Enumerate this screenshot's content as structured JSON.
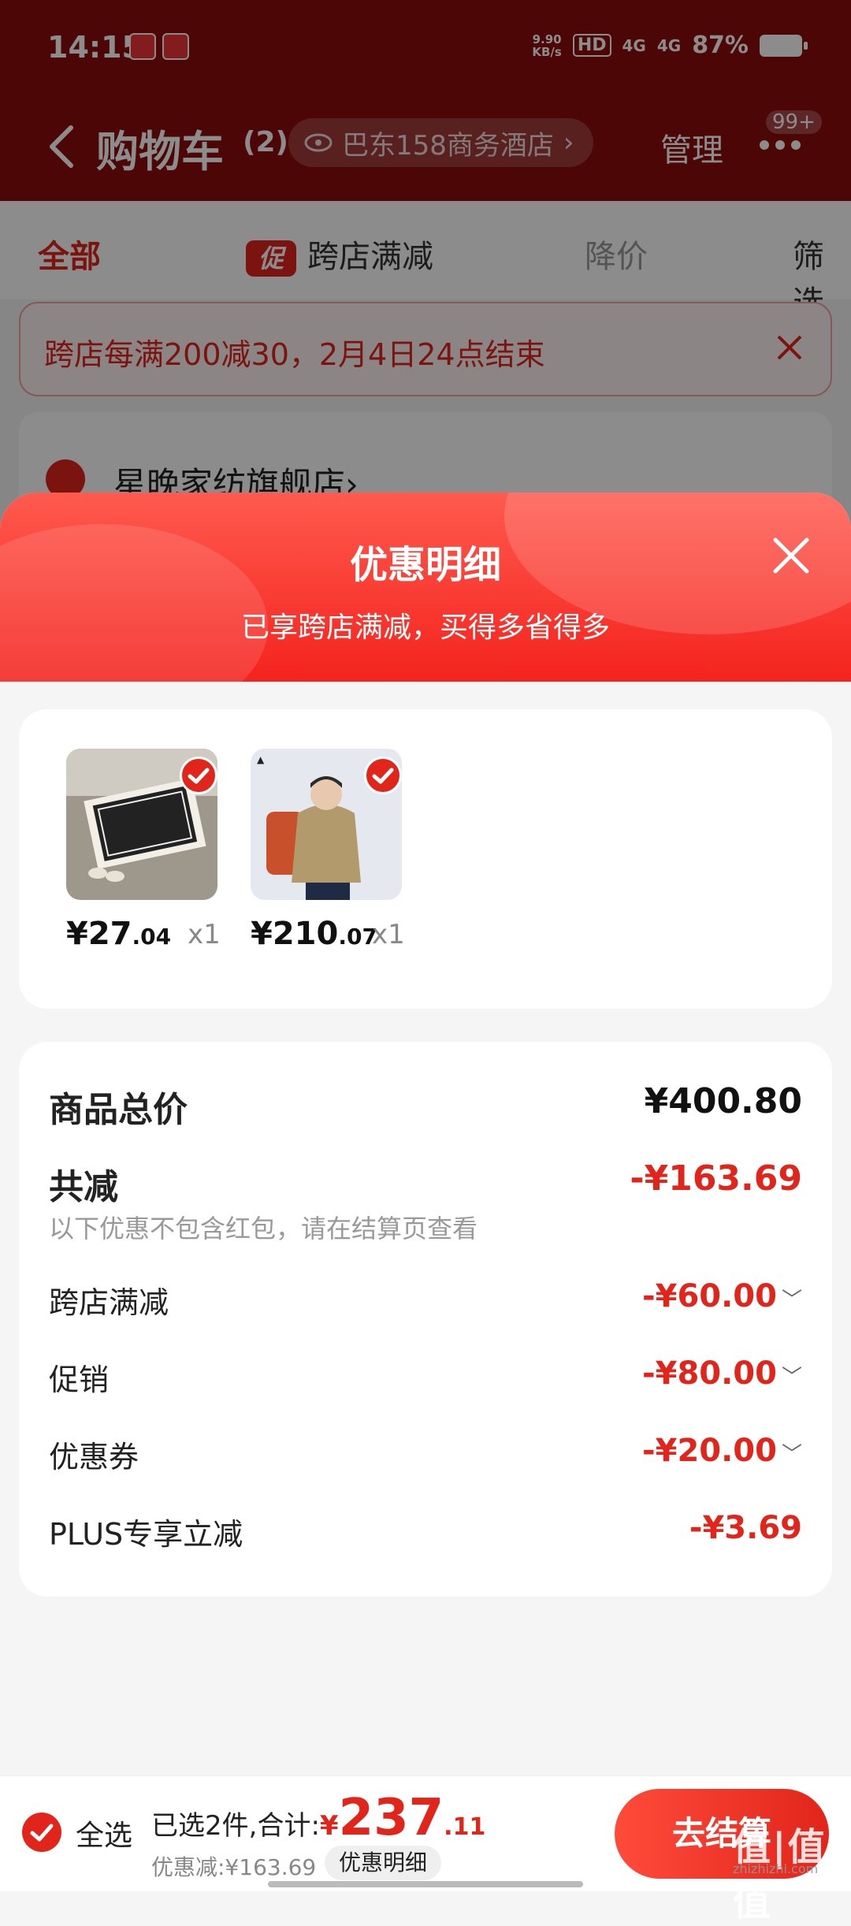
{
  "status_bar": {
    "time": "14:15",
    "net_speed": "9.90\nKB/s",
    "hd": "HD",
    "signal1": "4G",
    "signal2": "4G",
    "battery_pct": "87%"
  },
  "header": {
    "title": "购物车",
    "count": "(2)",
    "store_pill": "巴东158商务酒店",
    "manage_label": "管理",
    "message_badge": "99+"
  },
  "tabs": {
    "all": "全部",
    "promo_icon": "促",
    "cross_store": "跨店满减",
    "price_drop": "降价",
    "filter": "筛选"
  },
  "promo_banner": {
    "text": "跨店每满200减30，2月4日24点结束"
  },
  "shop": {
    "name": "星晚家纺旗舰店",
    "chevron": "›"
  },
  "sheet": {
    "title": "优惠明细",
    "subtitle": "已享跨店满减，买得多省得多",
    "goods": [
      {
        "yen": "¥",
        "int": "27",
        "cents": ".04",
        "qty": "x1"
      },
      {
        "yen": "¥",
        "int": "210",
        "cents": ".07",
        "qty": "x1"
      }
    ],
    "total_label": "商品总价",
    "total_value": "¥400.80",
    "reduce_label": "共减",
    "reduce_value": "-¥163.69",
    "reduce_note": "以下优惠不包含红包，请在结算页查看",
    "items": [
      {
        "label": "跨店满减",
        "value": "-¥60.00",
        "chevron": "﹀"
      },
      {
        "label": "促销",
        "value": "-¥80.00",
        "chevron": "﹀"
      },
      {
        "label": "优惠券",
        "value": "-¥20.00",
        "chevron": "﹀"
      },
      {
        "label": "PLUS专享立减",
        "value": "-¥3.69",
        "chevron": ""
      }
    ]
  },
  "bottom_bar": {
    "select_all": "全选",
    "selected_text": "已选2件,合计:",
    "total_yen": "¥",
    "total_int": "237",
    "total_cents": ".11",
    "discount_text": "优惠减:¥163.69",
    "detail_button": "优惠明细",
    "checkout_button": "去结算",
    "watermark": "值|值|值",
    "watermark_url": "zhizhizhi.com"
  },
  "colors": {
    "brand_red": "#e1251b",
    "header_dark_red": "#8d0b0b"
  }
}
